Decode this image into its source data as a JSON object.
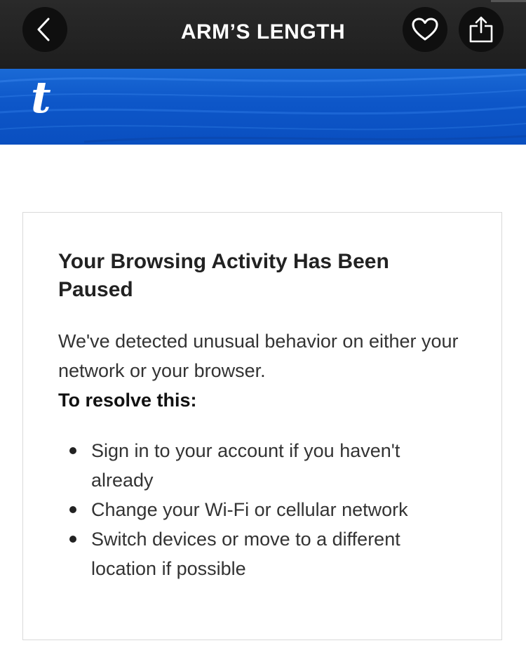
{
  "header": {
    "title": "ARM’S LENGTH",
    "back_icon": "chevron-left-icon",
    "favorite_icon": "heart-icon",
    "share_icon": "share-icon"
  },
  "banner": {
    "logo": "t",
    "color": "#0d56c8"
  },
  "card": {
    "title": "Your Browsing Activity Has Been Paused",
    "message": "We've detected unusual behavior on either your network or your browser.",
    "resolve_heading": "To resolve this:",
    "steps": [
      "Sign in to your account if you haven't already",
      "Change your Wi-Fi or cellular network",
      "Switch devices or move to a different location if possible"
    ]
  }
}
